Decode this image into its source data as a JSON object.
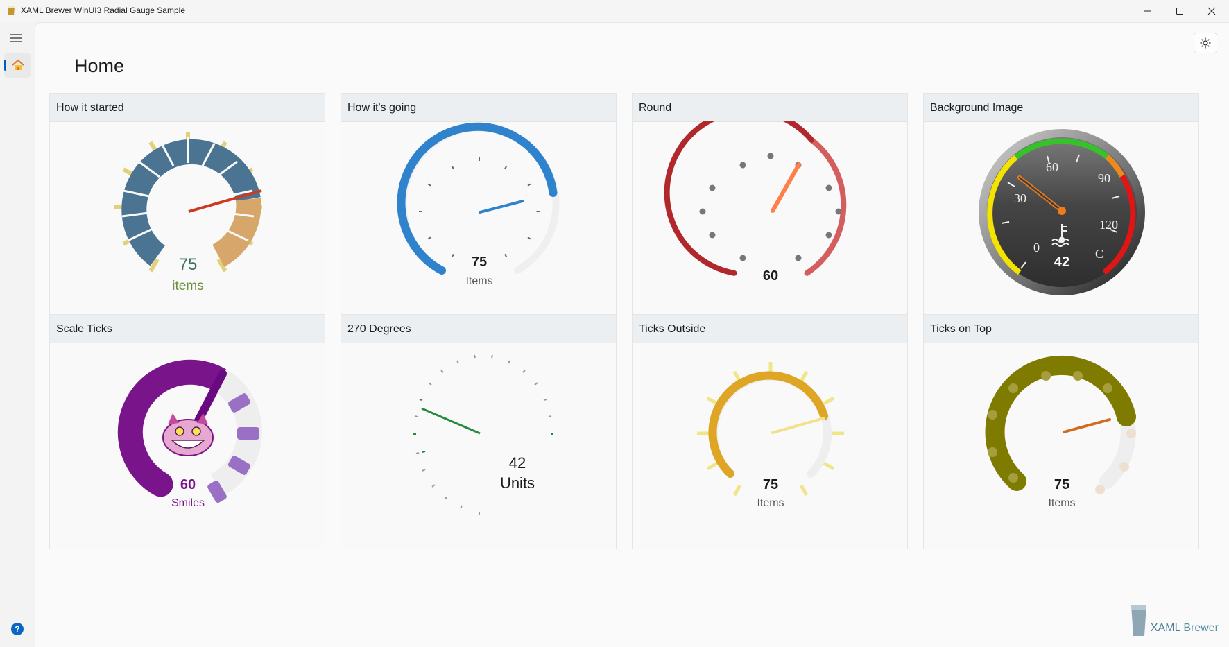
{
  "window": {
    "title": "XAML Brewer WinUI3 Radial Gauge Sample",
    "controls": [
      "minimize-icon",
      "maximize-icon",
      "close-icon"
    ]
  },
  "nav": {
    "items": [
      {
        "icon": "hamburger-icon"
      },
      {
        "icon": "home-icon",
        "selected": true
      }
    ],
    "footer_icon": "help-icon",
    "help_label": "?"
  },
  "page": {
    "title": "Home",
    "theme_toggle_icon": "sun-icon"
  },
  "cards": [
    {
      "title": "How it started",
      "value": "75",
      "unit": "items"
    },
    {
      "title": "How it's going",
      "value": "75",
      "unit": "Items"
    },
    {
      "title": "Round",
      "value": "60"
    },
    {
      "title": "Background Image",
      "value": "42",
      "scale_labels": [
        "0",
        "30",
        "60",
        "90",
        "120",
        "C"
      ]
    },
    {
      "title": "Scale Ticks",
      "value": "60",
      "unit": "Smiles"
    },
    {
      "title": "270 Degrees",
      "value": "42",
      "unit": "Units"
    },
    {
      "title": "Ticks Outside",
      "value": "75",
      "unit": "Items"
    },
    {
      "title": "Ticks on Top",
      "value": "75",
      "unit": "Items"
    }
  ],
  "brand": {
    "part1": "XAML",
    "part2": " Brewer"
  },
  "colors": {
    "accent": "#0067c0",
    "steel": "#4a7492",
    "tan": "#d6a66a",
    "blue": "#2f82cc",
    "red": "#b0282c",
    "purple": "#7a148a",
    "green": "#248a3d",
    "gold": "#dfa524",
    "olive": "#7f7a00"
  }
}
